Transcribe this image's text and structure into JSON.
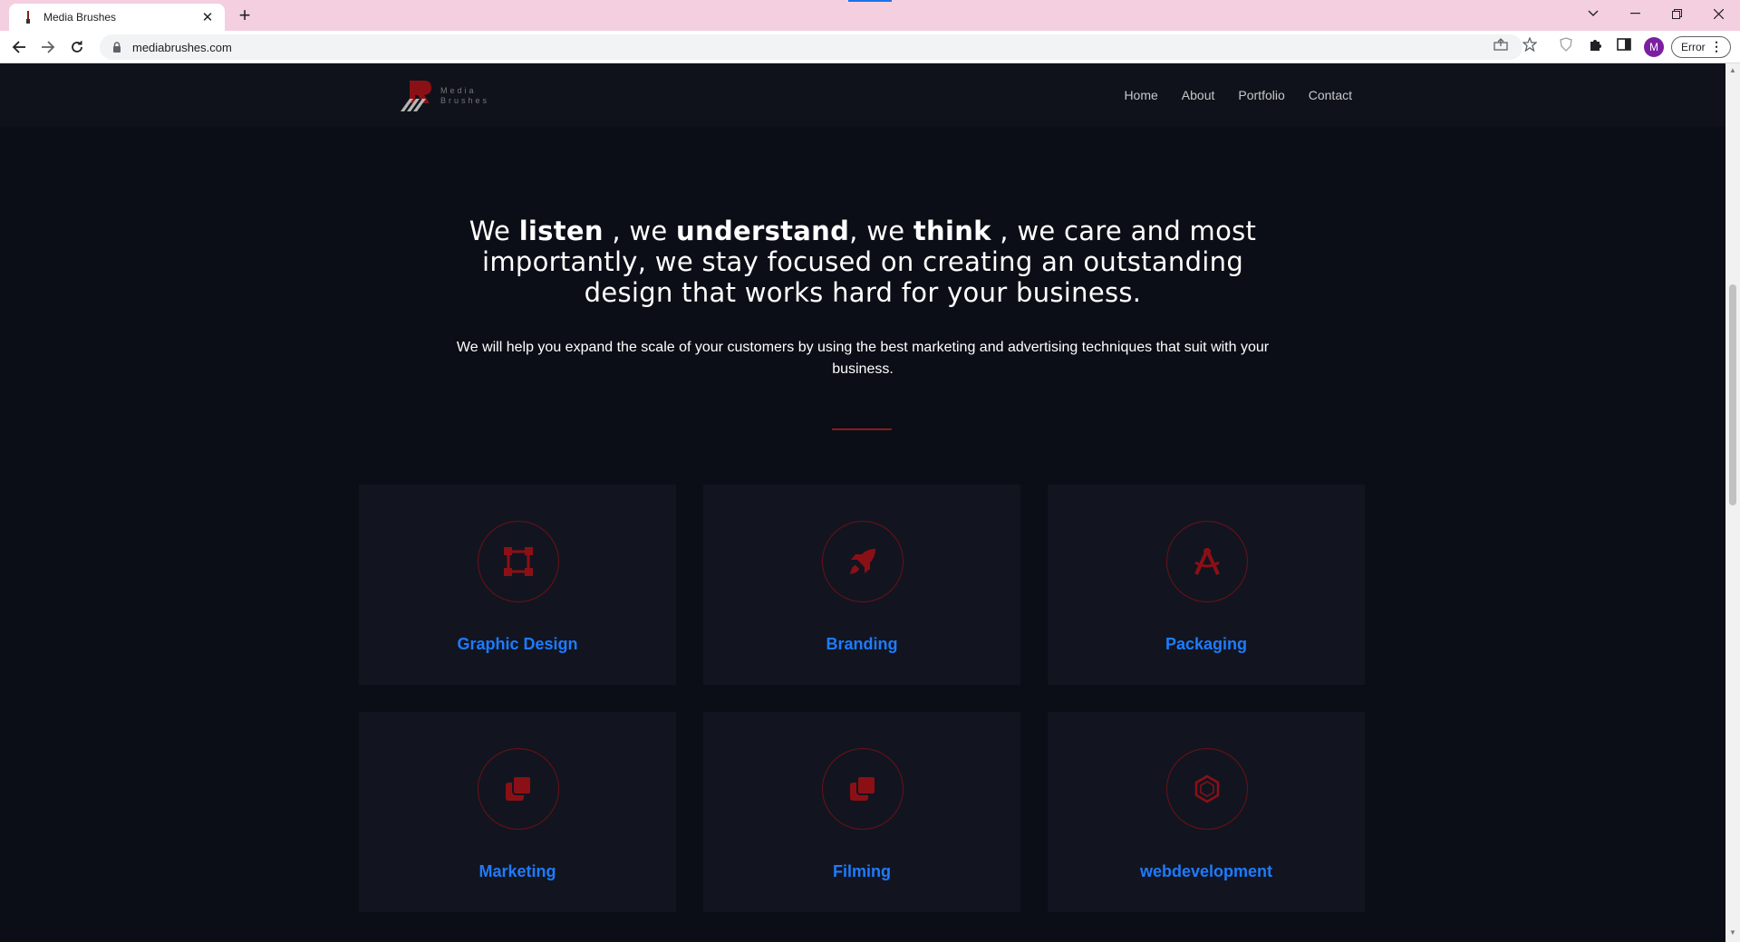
{
  "browser": {
    "tab_title": "Media Brushes",
    "url": "mediabrushes.com",
    "profile_initial": "M",
    "error_label": "Error"
  },
  "site": {
    "logo": {
      "line1": "Media",
      "line2": "Brushes"
    },
    "nav": [
      "Home",
      "About",
      "Portfolio",
      "Contact"
    ],
    "hero": {
      "h_we1": "We ",
      "h_listen": "listen",
      "h_we2": " , we ",
      "h_understand": "understand",
      "h_we3": ", we ",
      "h_think": "think",
      "h_rest": " , we care and most importantly, we stay focused on creating an outstanding design that works hard for your business.",
      "subtitle": "We will help you expand the scale of your customers by using the best marketing and advertising techniques that suit with your business."
    },
    "services": [
      {
        "title": "Graphic Design",
        "icon": "vector-square-icon"
      },
      {
        "title": "Branding",
        "icon": "rocket-icon"
      },
      {
        "title": "Packaging",
        "icon": "compass-drafting-icon"
      },
      {
        "title": "Marketing",
        "icon": "layers-icon"
      },
      {
        "title": "Filming",
        "icon": "layers-icon"
      },
      {
        "title": "webdevelopment",
        "icon": "hexagon-icon"
      }
    ]
  },
  "colors": {
    "accent_red": "#8b1a1a",
    "link_blue": "#1e7bff",
    "page_bg": "#0b0e16",
    "card_bg": "#121520"
  }
}
